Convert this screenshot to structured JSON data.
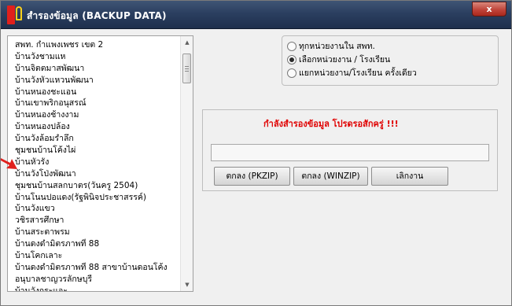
{
  "window": {
    "title": "สำรองข้อมูล (BACKUP DATA)",
    "close_label": "x"
  },
  "school_list": {
    "items": [
      "สพท. กำแพงเพชร เขต 2",
      "บ้านวังชามแห",
      "บ้านจิตตมาสพัฒนา",
      "บ้านวังหัวแหวนพัฒนา",
      "บ้านหนองชะแอน",
      "บ้านเขาพริกอนุสรณ์",
      "บ้านหนองช้างงาม",
      "บ้านหนองปล้อง",
      "บ้านวังล้อมรำลึก",
      "ชุมชนบ้านโค้งไผ่",
      "บ้านหัวรัง",
      "บ้านวังโป่งพัฒนา",
      "ชุมชนบ้านสลกบาตร(วันครู 2504)",
      "บ้านโนนปอแดง(รัฐพินิจประชาสรรค์)",
      "บ้านวังแขว",
      "วชิรสารศึกษา",
      "บ้านสระตาพรม",
      "บ้านดงดำมิตรภาพที่ 88",
      "บ้านโคกเลาะ",
      "บ้านดงดำมิตรภาพที่ 88 สาขาบ้านดอนโค้ง",
      "อนุบาลชาญวรลักษบุรี",
      "บ้านวังกระแจะ"
    ]
  },
  "scope_options": {
    "options": [
      {
        "label": "ทุกหน่วยงานใน สพท.",
        "selected": false
      },
      {
        "label": "เลือกหน่วยงาน / โรงเรียน",
        "selected": true
      },
      {
        "label": "แยกหน่วยงาน/โรงเรียน ครั้งเดียว",
        "selected": false
      }
    ]
  },
  "status": {
    "message": "กำลังสำรองข้อมูล  โปรดรอสักครู่ !!!",
    "color": "#e00000",
    "progress_value": ""
  },
  "buttons": {
    "pkzip": "ตกลง (PKZIP)",
    "winzip": "ตกลง (WINZIP)",
    "cancel": "เลิกงาน"
  }
}
